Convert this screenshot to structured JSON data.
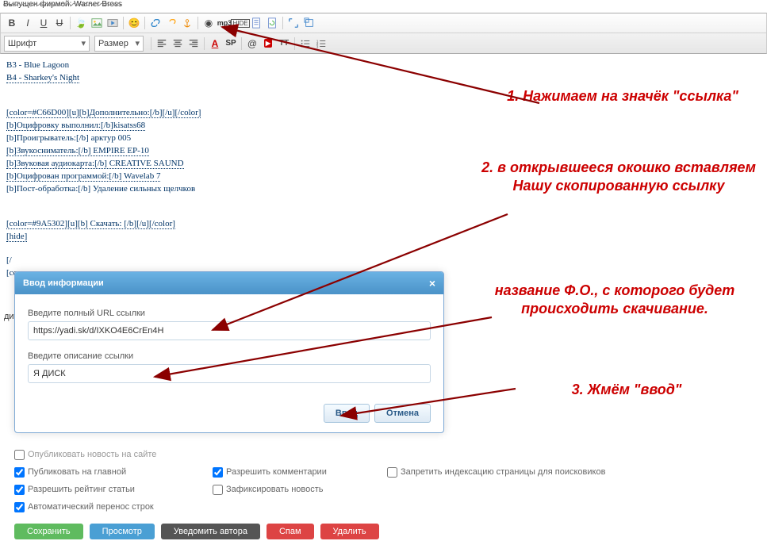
{
  "topbar_text": "Выпущен фирмой: Warner Bross",
  "toolbar": {
    "font_label": "Шрифт",
    "size_label": "Размер"
  },
  "editor_lines": [
    "B3 - Blue Lagoon",
    "B4 - Sharkey's Night",
    "",
    "",
    "[color=#C66D00][u][b]Дополнительно:[/b][/u][/color]",
    "[b]Оцифровку выполнил:[/b]kisatss68",
    "[b]Проигрыватель:[/b]  арктур 005",
    "[b]Звукосниматель:[/b] EMPIRE EP-10",
    "[b]Звуковая аудиокарта:[/b] CREATIVE SAUND",
    "[b]Оцифрован программой:[/b] Wavelab 7",
    "[b]Пост-обработка:[/b] Удаление сильных щелчков",
    "",
    "",
    "[color=#9A5302][u][b] Скачать: [/b][/u][/color]",
    "[hide]",
    "",
    "[/",
    "[co"
  ],
  "aside": "дить",
  "dialog": {
    "title": "Ввод информации",
    "label_url": "Введите полный URL ссылки",
    "value_url": "https://yadi.sk/d/IXKO4E6CrEn4H",
    "label_desc": "Введите описание ссылки",
    "value_desc": "Я ДИСК",
    "ok": "Ввод",
    "cancel": "Отмена"
  },
  "checks": {
    "r1c1": "Опубликовать новость на сайте",
    "r2c1": "Публиковать на главной",
    "r2c2": "Разрешить комментарии",
    "r2c3": "Запретить индексацию страницы для поисковиков",
    "r3c1": "Разрешить рейтинг статьи",
    "r3c2": "Зафиксировать новость",
    "r4c1": "Автоматический перенос строк"
  },
  "buttons": {
    "save": "Сохранить",
    "preview": "Просмотр",
    "notify": "Уведомить автора",
    "spam": "Спам",
    "delete": "Удалить"
  },
  "annot": {
    "a1": "1. Нажимаем на значёк \"ссылка\"",
    "a2": "2. в открывшееся окошко вставляем Нашу скопированную ссылку",
    "a3": "название Ф.О., с которого будет происходить скачивание.",
    "a4": "3. Жмём \"ввод\""
  }
}
